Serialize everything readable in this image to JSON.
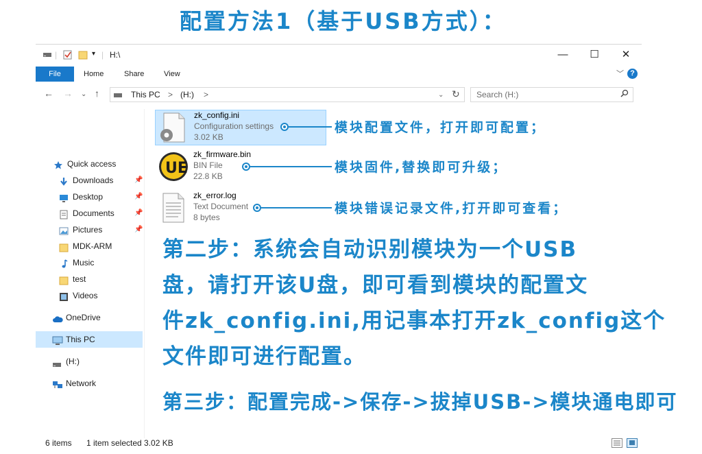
{
  "heading": "配置方法1（基于USB方式）：",
  "window": {
    "title": "H:\\",
    "controls": {
      "minimize": "—",
      "maximize": "☐",
      "close": "✕"
    }
  },
  "ribbon": {
    "tabs": [
      "File",
      "Home",
      "Share",
      "View"
    ],
    "help": "?"
  },
  "address": {
    "segments": [
      "This PC",
      ">",
      "(H:)",
      ">"
    ],
    "refresh": "↻"
  },
  "search": {
    "placeholder": "Search  (H:)"
  },
  "sidebar": {
    "items": [
      {
        "label": "Quick access",
        "icon": "star-icon",
        "pinned": false
      },
      {
        "label": "Downloads",
        "icon": "download-arrow-icon",
        "pinned": true
      },
      {
        "label": "Desktop",
        "icon": "desktop-icon",
        "pinned": true
      },
      {
        "label": "Documents",
        "icon": "documents-icon",
        "pinned": true
      },
      {
        "label": "Pictures",
        "icon": "pictures-icon",
        "pinned": true
      },
      {
        "label": "MDK-ARM",
        "icon": "folder-icon",
        "pinned": false
      },
      {
        "label": "Music",
        "icon": "music-note-icon",
        "pinned": false
      },
      {
        "label": "test",
        "icon": "folder-icon",
        "pinned": false
      },
      {
        "label": "Videos",
        "icon": "video-icon",
        "pinned": false
      },
      {
        "label": "OneDrive",
        "icon": "cloud-icon",
        "pinned": false
      },
      {
        "label": "This PC",
        "icon": "computer-icon",
        "pinned": false
      },
      {
        "label": "(H:)",
        "icon": "drive-icon",
        "pinned": false
      },
      {
        "label": "Network",
        "icon": "network-icon",
        "pinned": false
      }
    ]
  },
  "files": [
    {
      "name": "zk_config.ini",
      "type": "Configuration settings",
      "size": "3.02 KB",
      "icon": "config-file-gear-icon",
      "selected": true,
      "note": "模块配置文件，打开即可配置；"
    },
    {
      "name": "zk_firmware.bin",
      "type": "BIN File",
      "size": "22.8 KB",
      "icon": "ultraedit-ue-icon",
      "selected": false,
      "note": "模块固件,替换即可升级；"
    },
    {
      "name": "zk_error.log",
      "type": "Text Document",
      "size": "8 bytes",
      "icon": "text-document-icon",
      "selected": false,
      "note": "模块错误记录文件,打开即可查看；"
    }
  ],
  "steps": {
    "step2": [
      "第二步：系统会自动识别模块为一个USB",
      "盘，请打开该U盘，即可看到模块的配置文",
      "件zk_config.ini,用记事本打开zk_config这个",
      "文件即可进行配置。"
    ],
    "step3": "第三步：配置完成->保存->拔掉USB->模块通电即可"
  },
  "status": {
    "count": "6 items",
    "selection": "1 item selected  3.02 KB"
  },
  "colors": {
    "accent": "#1979ca",
    "annotation": "#1b86c9",
    "selection": "#cce8ff"
  }
}
